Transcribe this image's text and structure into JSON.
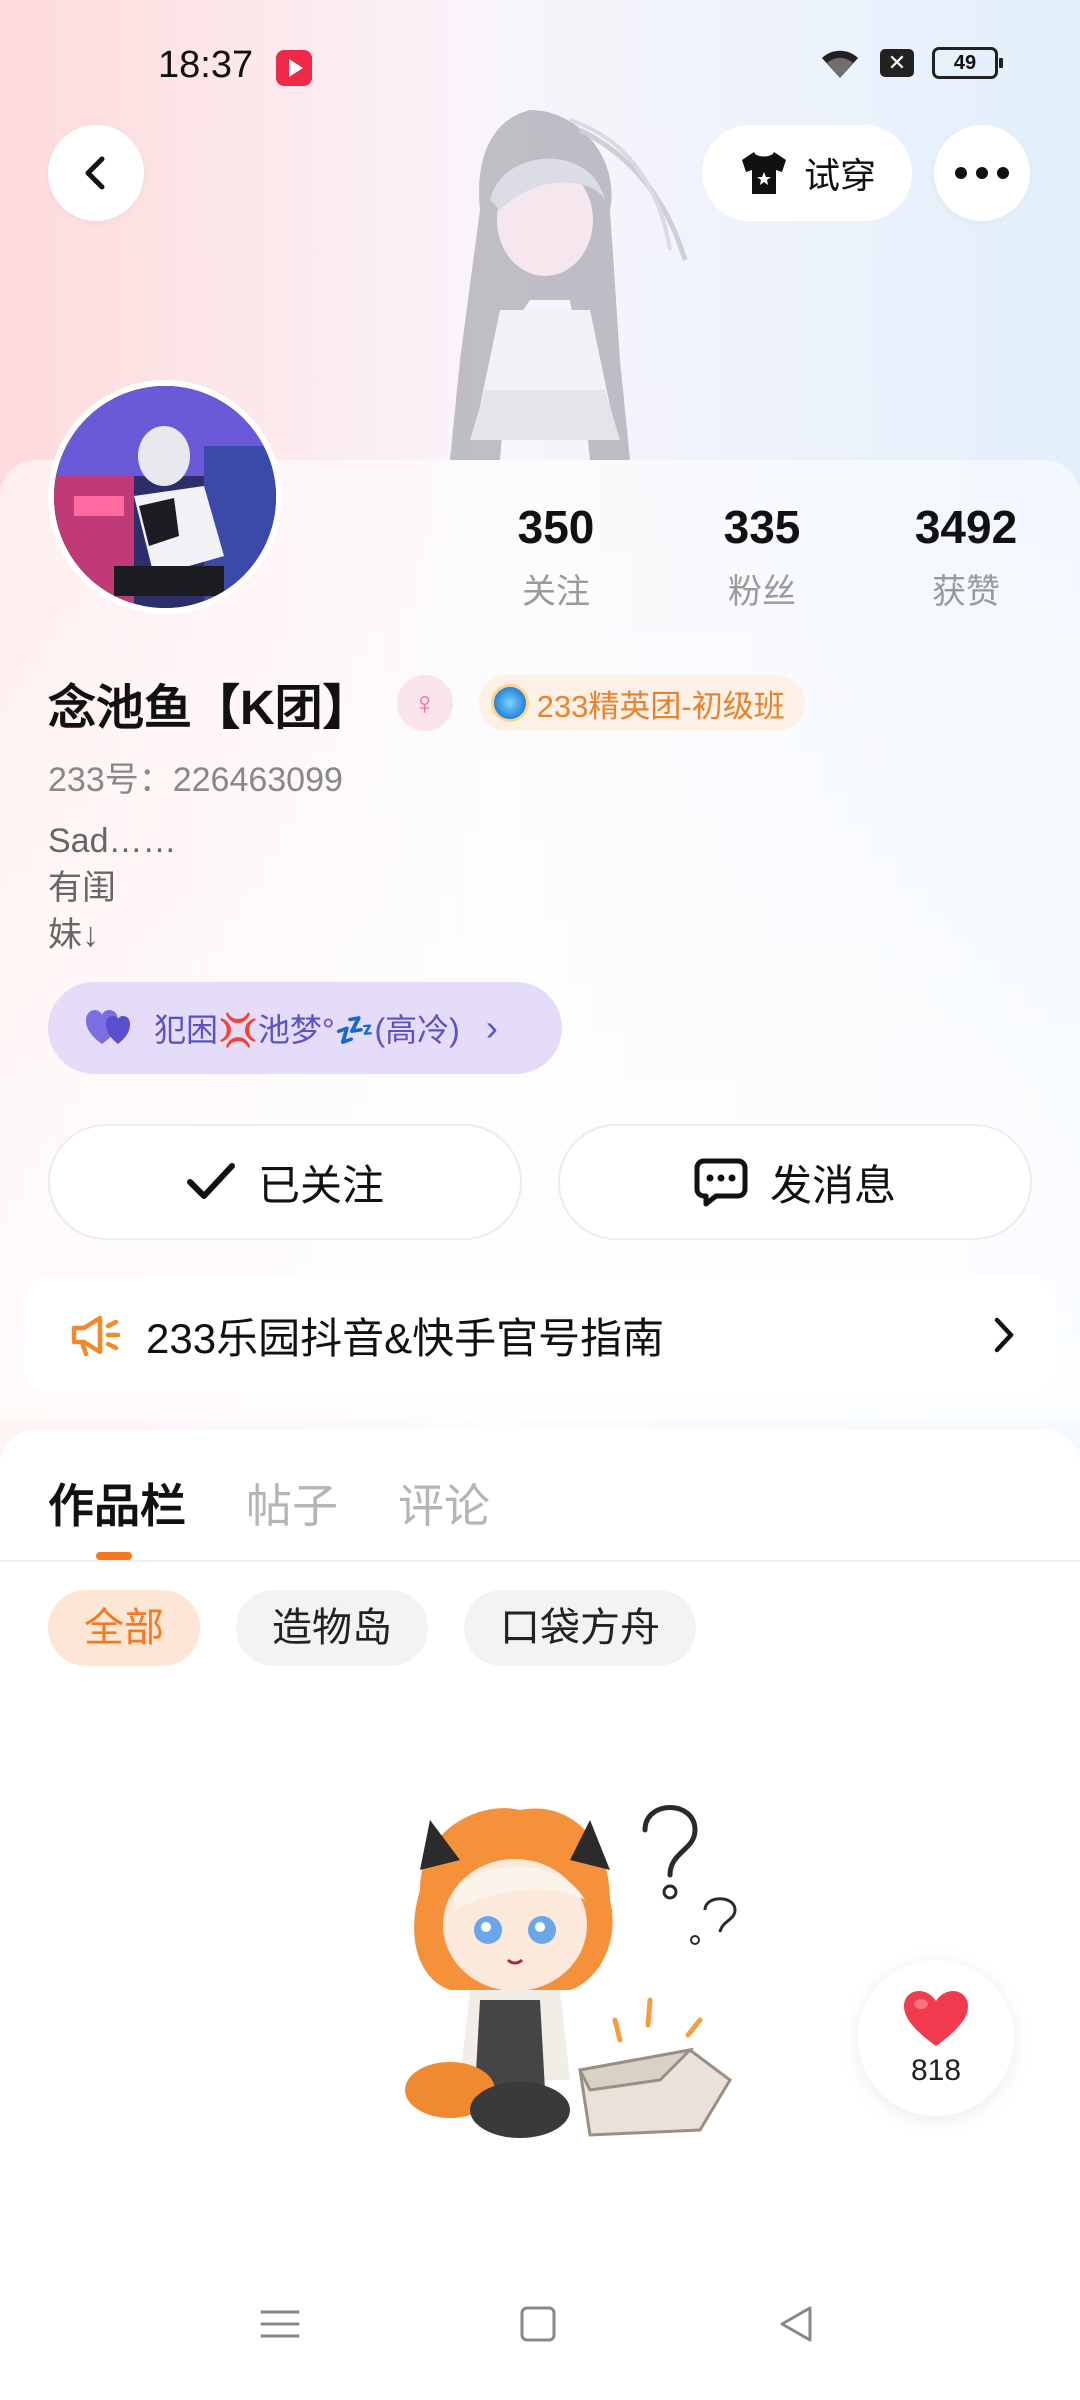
{
  "status_bar": {
    "time": "18:37",
    "battery": "49",
    "icons": [
      "video-app-icon",
      "wifi-icon",
      "x-box-icon",
      "battery-icon"
    ]
  },
  "top_bar": {
    "try_on_label": "试穿"
  },
  "stats": [
    {
      "value": "350",
      "label": "关注"
    },
    {
      "value": "335",
      "label": "粉丝"
    },
    {
      "value": "3492",
      "label": "获赞"
    }
  ],
  "profile": {
    "name": "念池鱼【K团】",
    "gender_symbol": "♀",
    "rank_badge": "233精英团-初级班",
    "uid": "233号：226463099",
    "bio_lines": [
      "Sad……",
      "有闺",
      "妹↓"
    ],
    "fan_badge": "犯困💢池梦°💤(高冷)"
  },
  "actions": {
    "follow_label": "已关注",
    "message_label": "发消息"
  },
  "guide": {
    "text": "233乐园抖音&快手官号指南"
  },
  "tabs": [
    {
      "label": "作品栏",
      "active": true
    },
    {
      "label": "帖子",
      "active": false
    },
    {
      "label": "评论",
      "active": false
    }
  ],
  "filters": [
    {
      "label": "全部",
      "active": true
    },
    {
      "label": "造物岛",
      "active": false
    },
    {
      "label": "口袋方舟",
      "active": false
    }
  ],
  "like_float": {
    "count": "818"
  },
  "colors": {
    "accent": "#f47a22",
    "fan_badge_bg": "#e4dcf8",
    "fan_badge_text": "#5b52c6",
    "like_heart": "#f23b4e"
  }
}
